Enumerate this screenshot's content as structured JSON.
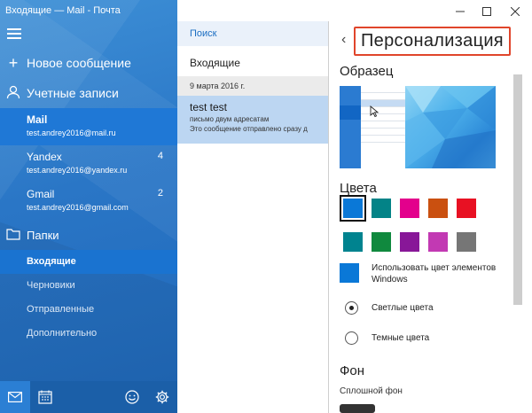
{
  "window": {
    "title": "Входящие — Mail - Почта",
    "controls": [
      "minimize-icon",
      "maximize-icon",
      "close-icon"
    ]
  },
  "nav": {
    "new_message": "Новое сообщение",
    "accounts_label": "Учетные записи",
    "accounts": [
      {
        "name": "Mail",
        "email": "test.andrey2016@mail.ru",
        "count": "",
        "selected": true
      },
      {
        "name": "Yandex",
        "email": "test.andrey2016@yandex.ru",
        "count": "4",
        "selected": false
      },
      {
        "name": "Gmail",
        "email": "test.andrey2016@gmail.com",
        "count": "2",
        "selected": false
      }
    ],
    "folders_label": "Папки",
    "folders": [
      {
        "label": "Входящие",
        "selected": true
      },
      {
        "label": "Черновики",
        "selected": false
      },
      {
        "label": "Отправленные",
        "selected": false
      },
      {
        "label": "Дополнительно",
        "selected": false
      }
    ],
    "bottom_icons": [
      "mail-icon",
      "calendar-icon",
      "smiley-icon",
      "settings-gear-icon"
    ]
  },
  "list": {
    "search": "Поиск",
    "inbox_title": "Входящие",
    "date": "9 марта 2016 г.",
    "message": {
      "from": "test test",
      "subject": "письмо двум адресатам",
      "preview": "Это сообщение отправлено сразу д"
    }
  },
  "personalization": {
    "title": "Персонализация",
    "sample_label": "Образец",
    "colors_label": "Цвета",
    "colors": [
      "#0a78d7",
      "#038387",
      "#e3008c",
      "#ca5010",
      "#e81123",
      "#00838f",
      "#10893e",
      "#881798",
      "#c239b3",
      "#767676"
    ],
    "selected_color": "#0a78d7",
    "use_accent_label": "Использовать цвет элементов Windows",
    "light_label": "Светлые цвета",
    "dark_label": "Темные цвета",
    "light_selected": true,
    "background_label": "Фон",
    "solid_bg_label": "Сплошной фон"
  },
  "colors": {
    "nav_bg": "#2a76c6",
    "accent": "#0a78d7",
    "highlight_box": "#e0452b"
  }
}
